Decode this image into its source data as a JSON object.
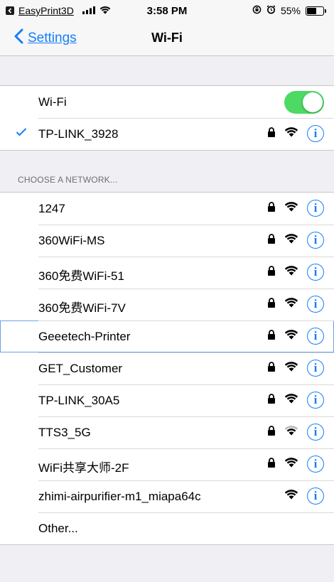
{
  "status_bar": {
    "back_app": "EasyPrint3D",
    "time": "3:58 PM",
    "battery": "55%",
    "battery_level": 0.55
  },
  "nav": {
    "back_label": "Settings",
    "title": "Wi-Fi"
  },
  "wifi": {
    "label": "Wi-Fi",
    "enabled": true,
    "connected_network": "TP-LINK_3928"
  },
  "section_header": "CHOOSE A NETWORK...",
  "networks": [
    {
      "name": "1247",
      "secure": true,
      "signal": "full"
    },
    {
      "name": "360WiFi-MS",
      "secure": true,
      "signal": "full"
    },
    {
      "name": "360免费WiFi-51",
      "secure": true,
      "signal": "full"
    },
    {
      "name": "360免费WiFi-7V",
      "secure": true,
      "signal": "full"
    },
    {
      "name": "Geeetech-Printer",
      "secure": true,
      "signal": "full"
    },
    {
      "name": "GET_Customer",
      "secure": true,
      "signal": "full"
    },
    {
      "name": "TP-LINK_30A5",
      "secure": true,
      "signal": "full"
    },
    {
      "name": "TTS3_5G",
      "secure": true,
      "signal": "weak"
    },
    {
      "name": "WiFi共享大师-2F",
      "secure": true,
      "signal": "full"
    },
    {
      "name": "zhimi-airpurifier-m1_miapa64c",
      "secure": false,
      "signal": "full"
    }
  ],
  "other_label": "Other...",
  "colors": {
    "accent": "#157efb",
    "toggle_on": "#4cd964",
    "background": "#efeff4"
  },
  "icons": {
    "lock": "lock-icon",
    "wifi": "wifi-icon",
    "info": "info-icon",
    "check": "checkmark-icon",
    "back": "chevron-left-icon"
  }
}
